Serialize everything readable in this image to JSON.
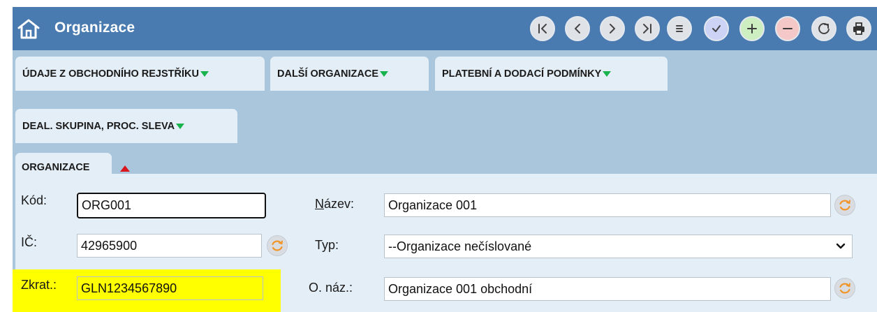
{
  "app": {
    "title": "Organizace",
    "home_icon": "home-icon"
  },
  "toolbar": {
    "buttons": [
      {
        "name": "first-record-button",
        "icon": "first-icon"
      },
      {
        "name": "previous-record-button",
        "icon": "chevron-left-icon"
      },
      {
        "name": "next-record-button",
        "icon": "chevron-right-icon"
      },
      {
        "name": "last-record-button",
        "icon": "last-icon"
      },
      {
        "name": "list-button",
        "icon": "list-icon"
      },
      {
        "name": "confirm-button",
        "icon": "check-icon"
      },
      {
        "name": "add-button",
        "icon": "plus-icon"
      },
      {
        "name": "remove-button",
        "icon": "minus-icon"
      },
      {
        "name": "refresh-button",
        "icon": "refresh-icon"
      },
      {
        "name": "print-button",
        "icon": "print-icon"
      }
    ],
    "colors": {
      "add": "#cdeec0",
      "remove": "#f5c8c8",
      "check": "#cdd3f5"
    }
  },
  "tabs": [
    {
      "label": "ÚDAJE Z OBCHODNÍHO REJSTŘÍKU",
      "expanded": false
    },
    {
      "label": "DALŠÍ ORGANIZACE",
      "expanded": false
    },
    {
      "label": "PLATEBNÍ A DODACÍ PODMÍNKY",
      "expanded": false
    },
    {
      "label": "DEAL. SKUPINA, PROC. SLEVA",
      "expanded": false
    }
  ],
  "panel": {
    "title": "ORGANIZACE",
    "expanded": true
  },
  "form": {
    "kod_label": "Kód:",
    "kod_value": "ORG001",
    "ic_label": "IČ:",
    "ic_value": "42965900",
    "zkrat_label": "Zkrat.:",
    "zkrat_value": "GLN1234567890",
    "nazev_label_first": "N",
    "nazev_label_rest": "ázev:",
    "nazev_value": "Organizace 001",
    "typ_label": "Typ:",
    "typ_value": "--Organizace nečíslované",
    "onaz_label": "O. náz.:",
    "onaz_value": "Organizace 001 obchodní"
  },
  "colors": {
    "titlebar": "#4a7bb0",
    "background": "#a9c6dd",
    "panel": "#e4eef6",
    "highlight": "#ffff00",
    "tab_arrow": "#18b34d",
    "panel_arrow": "#d9151d",
    "refresh_icon": "#f0962a"
  }
}
